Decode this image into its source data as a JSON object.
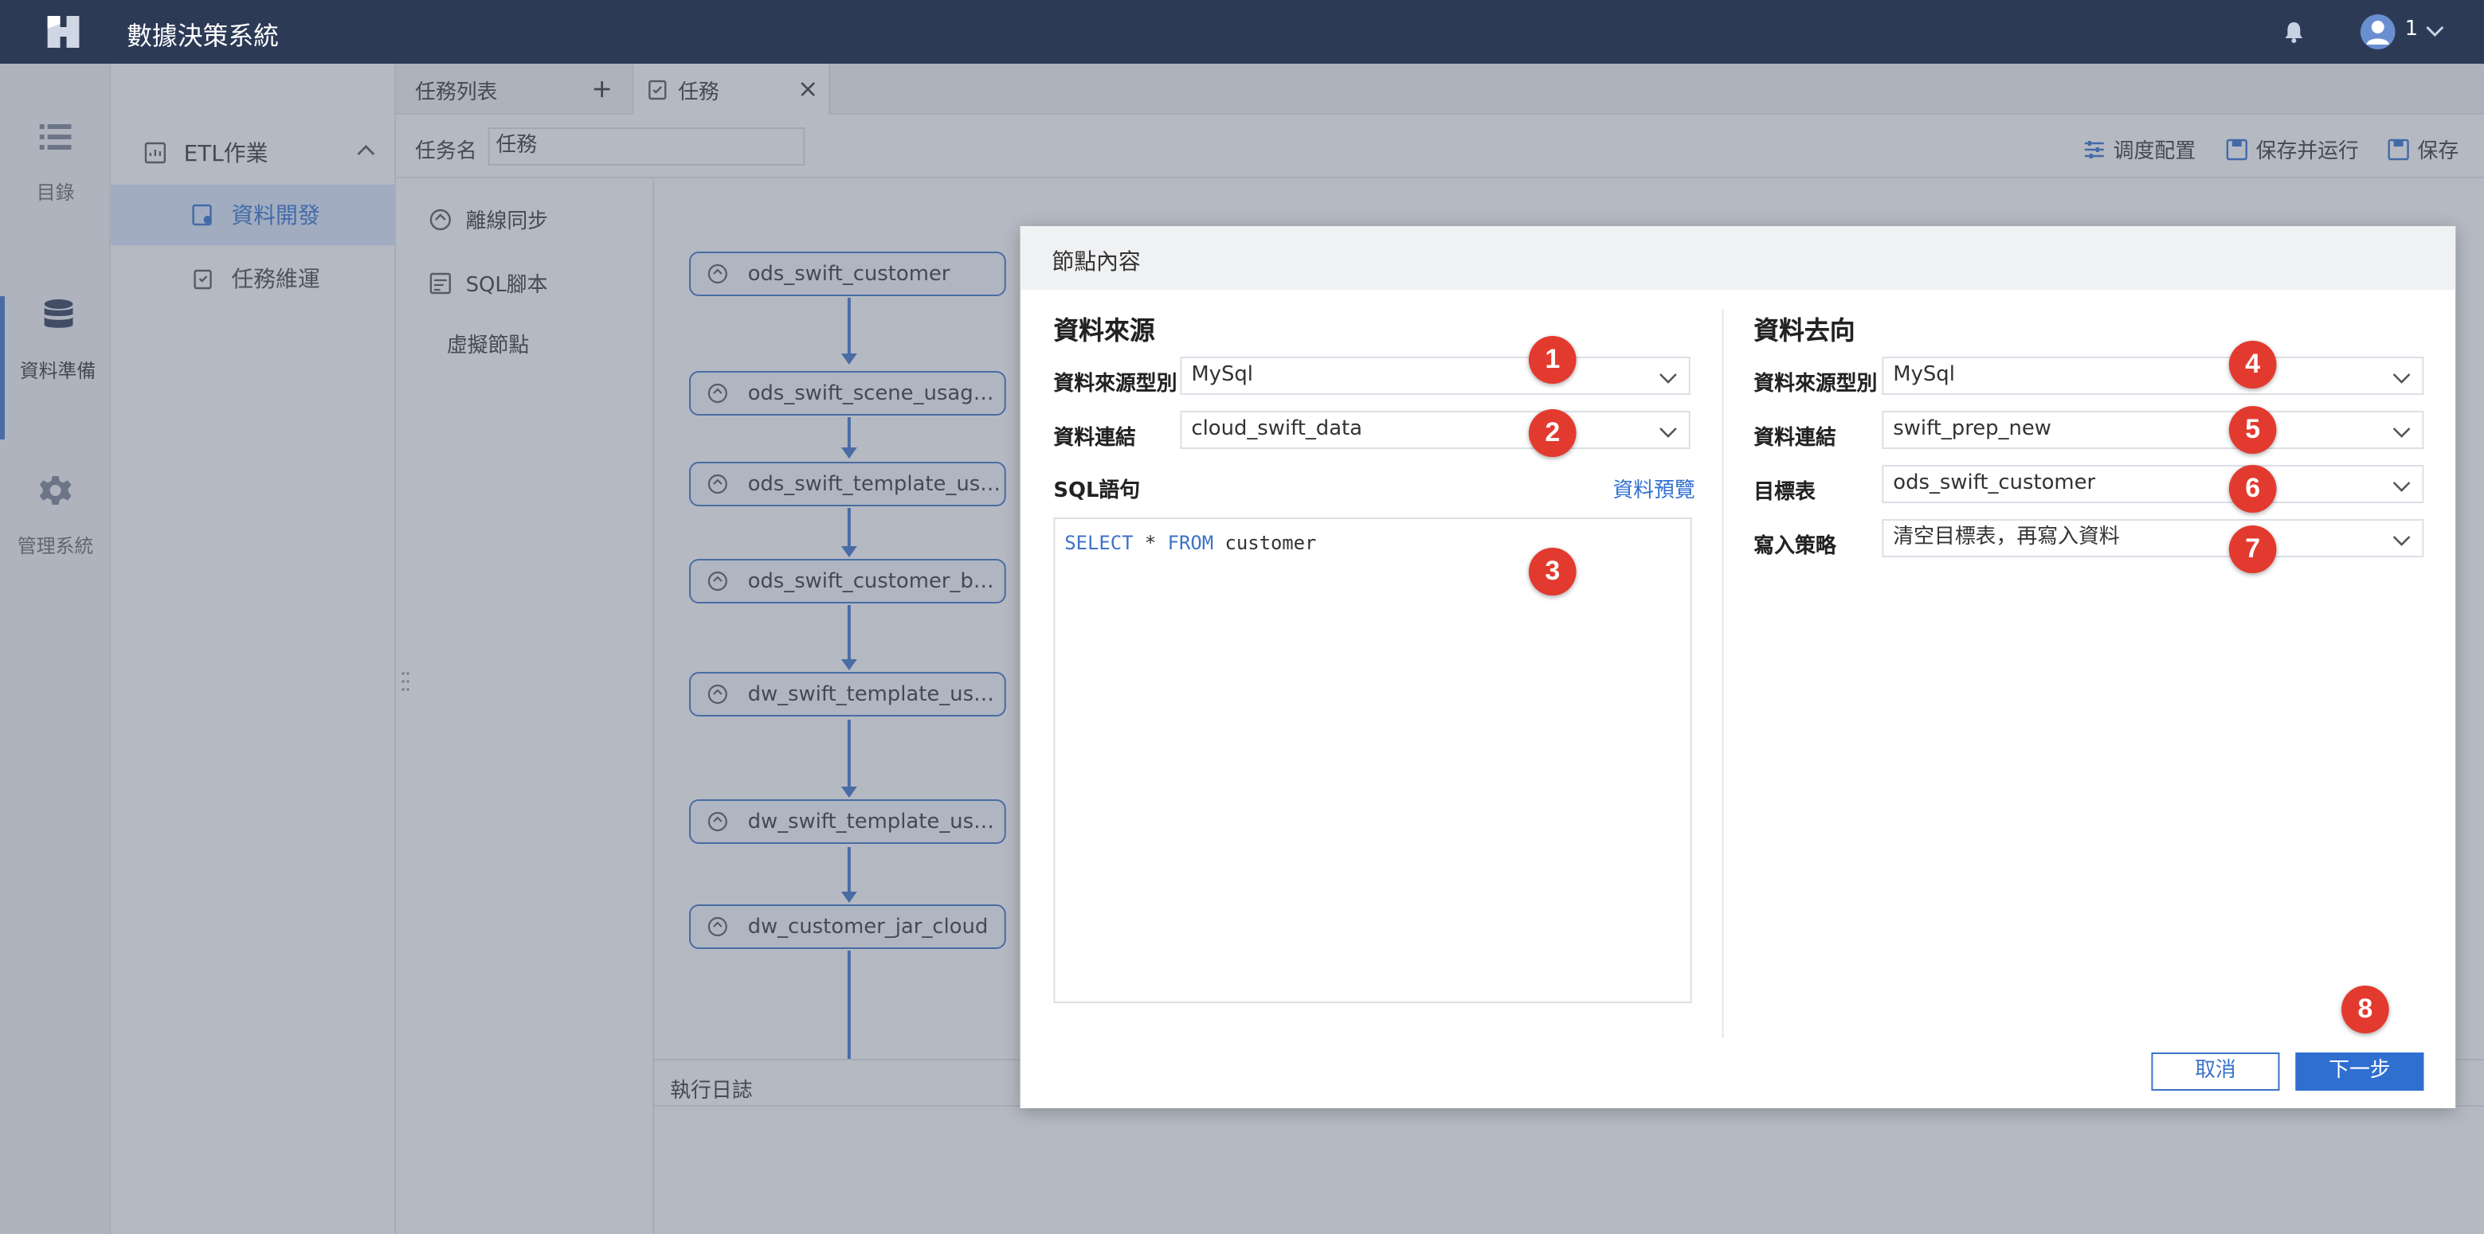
{
  "app": {
    "title": "數據決策系統",
    "user": "1"
  },
  "left_nav": [
    {
      "label": "目錄",
      "icon": "list-icon"
    },
    {
      "label": "資料準備",
      "icon": "database-icon"
    },
    {
      "label": "管理系統",
      "icon": "gear-icon"
    }
  ],
  "submenu": {
    "group": "ETL作業",
    "items": [
      {
        "label": "資料開發"
      },
      {
        "label": "任務維運"
      }
    ]
  },
  "tabs": {
    "list": "任務列表",
    "task": "任務"
  },
  "toolbar": {
    "name_label": "任务名",
    "name_value": "任務",
    "schedule": "调度配置",
    "save_run": "保存并运行",
    "save": "保存"
  },
  "palette": [
    "離線同步",
    "SQL腳本",
    "虛擬節點"
  ],
  "nodes": [
    "ods_swift_customer",
    "ods_swift_scene_usage...",
    "ods_swift_template_usa...",
    "ods_swift_customer_bas...",
    "dw_swift_template_usag...",
    "dw_swift_template_usag...",
    "dw_customer_jar_cloud"
  ],
  "log_label": "執行日誌",
  "dialog": {
    "title": "節點內容",
    "source": {
      "title": "資料來源",
      "type_label": "資料來源型別",
      "type_value": "MySql",
      "conn_label": "資料連結",
      "conn_value": "cloud_swift_data",
      "sql_label": "SQL語句",
      "preview_link": "資料預覽",
      "sql": {
        "kw1": "SELECT",
        "star": " * ",
        "kw2": "FROM",
        "table": " customer"
      }
    },
    "target": {
      "title": "資料去向",
      "type_label": "資料來源型別",
      "type_value": "MySql",
      "conn_label": "資料連結",
      "conn_value": "swift_prep_new",
      "table_label": "目標表",
      "table_value": "ods_swift_customer",
      "strategy_label": "寫入策略",
      "strategy_value": "清空目標表，再寫入資料"
    },
    "cancel": "取消",
    "next": "下一步"
  },
  "badges": [
    "1",
    "2",
    "3",
    "4",
    "5",
    "6",
    "7",
    "8"
  ],
  "colors": {
    "topbar": "#2c3a56",
    "accent": "#2f6fd0",
    "badge": "#e33a2f"
  }
}
